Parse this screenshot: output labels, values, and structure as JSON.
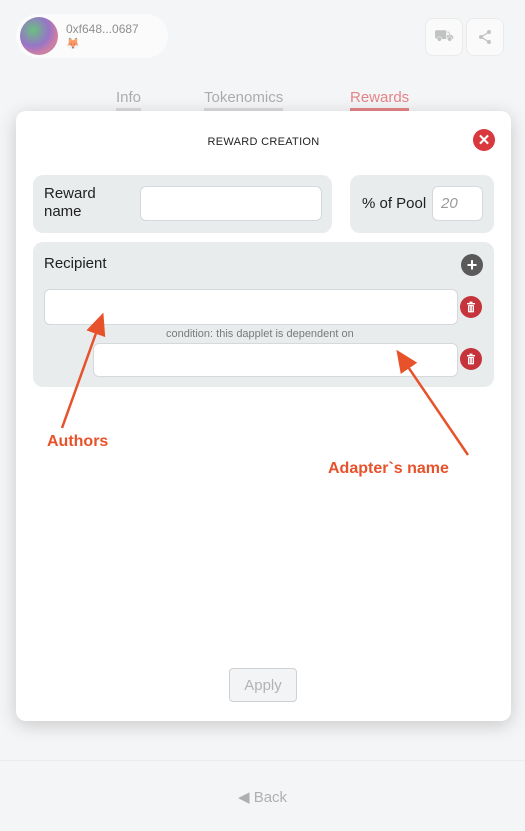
{
  "header": {
    "account": "0xf648...0687",
    "wallet_icon": "fox-icon",
    "cart_icon": "cart-icon",
    "share_icon": "share-icon"
  },
  "tabs": [
    {
      "label": "Info"
    },
    {
      "label": "Tokenomics"
    },
    {
      "label": "Rewards",
      "color": "#d9383f"
    }
  ],
  "modal": {
    "title": "REWARD CREATION",
    "reward_name_label": "Reward name",
    "reward_name_value": "",
    "pool_label": "% of Pool",
    "pool_placeholder": "20",
    "recipient_label": "Recipient",
    "recipient_value": "",
    "condition_text": "condition: this dapplet is dependent on",
    "adapter_value": "",
    "apply_label": "Apply"
  },
  "annotations": {
    "authors": "Authors",
    "adapter_name": "Adapter`s name"
  },
  "footer": {
    "back_label": "Back"
  },
  "colors": {
    "accent_red": "#d9383f",
    "annotation_orange": "#e8522b",
    "panel_gray": "#e8eced"
  }
}
